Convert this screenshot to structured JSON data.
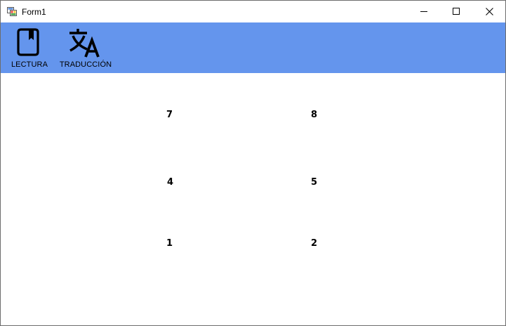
{
  "window": {
    "title": "Form1",
    "icon": "winforms-app-icon",
    "controls": {
      "minimize_icon": "minimize-icon",
      "maximize_icon": "maximize-icon",
      "close_icon": "close-icon"
    }
  },
  "toolbar": {
    "background": "#6495ED",
    "buttons": [
      {
        "label": "LECTURA",
        "icon": "book-icon"
      },
      {
        "label": "TRADUCCIÓN",
        "icon": "translate-icon"
      }
    ]
  },
  "content": {
    "numbers": [
      "7",
      "8",
      "4",
      "5",
      "1",
      "2"
    ]
  }
}
